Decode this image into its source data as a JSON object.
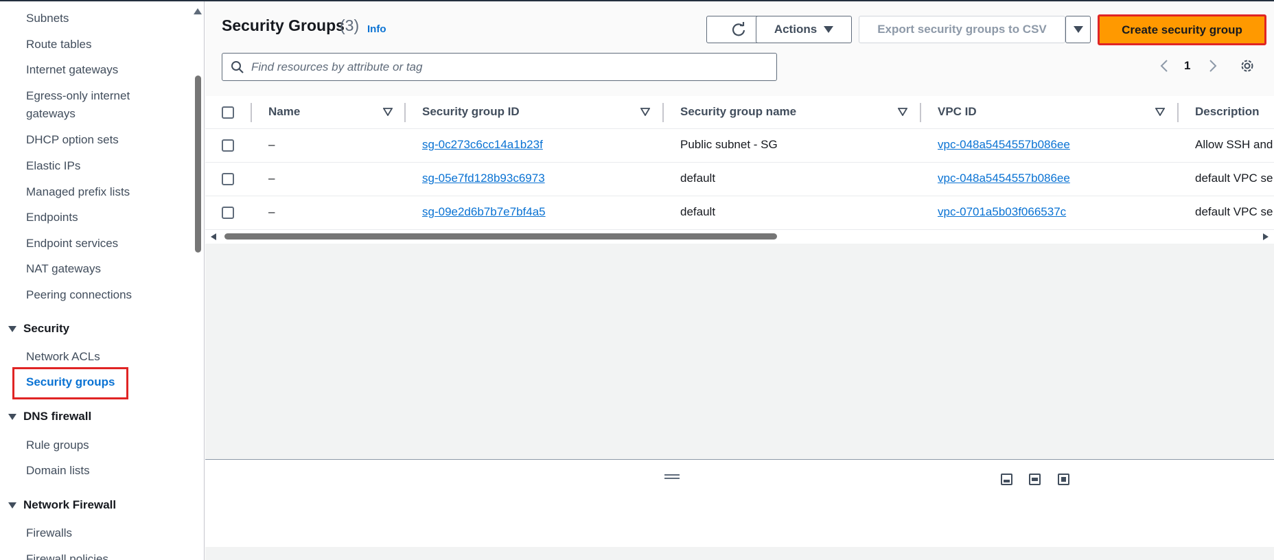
{
  "sidebar": {
    "items": [
      {
        "label": "Subnets"
      },
      {
        "label": "Route tables"
      },
      {
        "label": "Internet gateways"
      },
      {
        "label": "Egress-only internet"
      },
      {
        "label": "gateways"
      },
      {
        "label": "DHCP option sets"
      },
      {
        "label": "Elastic IPs"
      },
      {
        "label": "Managed prefix lists"
      },
      {
        "label": "Endpoints"
      },
      {
        "label": "Endpoint services"
      },
      {
        "label": "NAT gateways"
      },
      {
        "label": "Peering connections"
      }
    ],
    "security": {
      "title": "Security",
      "items": [
        {
          "label": "Network ACLs"
        },
        {
          "label": "Security groups",
          "active": true
        }
      ]
    },
    "dns_firewall": {
      "title": "DNS firewall",
      "items": [
        {
          "label": "Rule groups"
        },
        {
          "label": "Domain lists"
        }
      ]
    },
    "network_firewall": {
      "title": "Network Firewall",
      "items": [
        {
          "label": "Firewalls"
        },
        {
          "label": "Firewall policies"
        }
      ]
    }
  },
  "header": {
    "title": "Security Groups",
    "count": "(3)",
    "info": "Info",
    "actions_label": "Actions",
    "export_label": "Export security groups to CSV",
    "create_label": "Create security group"
  },
  "search": {
    "placeholder": "Find resources by attribute or tag"
  },
  "pagination": {
    "current_page": "1"
  },
  "table": {
    "columns": [
      "Name",
      "Security group ID",
      "Security group name",
      "VPC ID",
      "Description"
    ],
    "rows": [
      {
        "name": "–",
        "sg_id": "sg-0c273c6cc14a1b23f",
        "sg_name": "Public subnet - SG",
        "vpc_id": "vpc-048a5454557b086ee",
        "description": "Allow SSH and"
      },
      {
        "name": "–",
        "sg_id": "sg-05e7fd128b93c6973",
        "sg_name": "default",
        "vpc_id": "vpc-048a5454557b086ee",
        "description": "default VPC se"
      },
      {
        "name": "–",
        "sg_id": "sg-09e2d6b7b7e7bf4a5",
        "sg_name": "default",
        "vpc_id": "vpc-0701a5b03f066537c",
        "description": "default VPC se"
      }
    ]
  },
  "colors": {
    "accent": "#0972d3",
    "primary_button": "#ff9900",
    "highlight": "#e02424"
  }
}
